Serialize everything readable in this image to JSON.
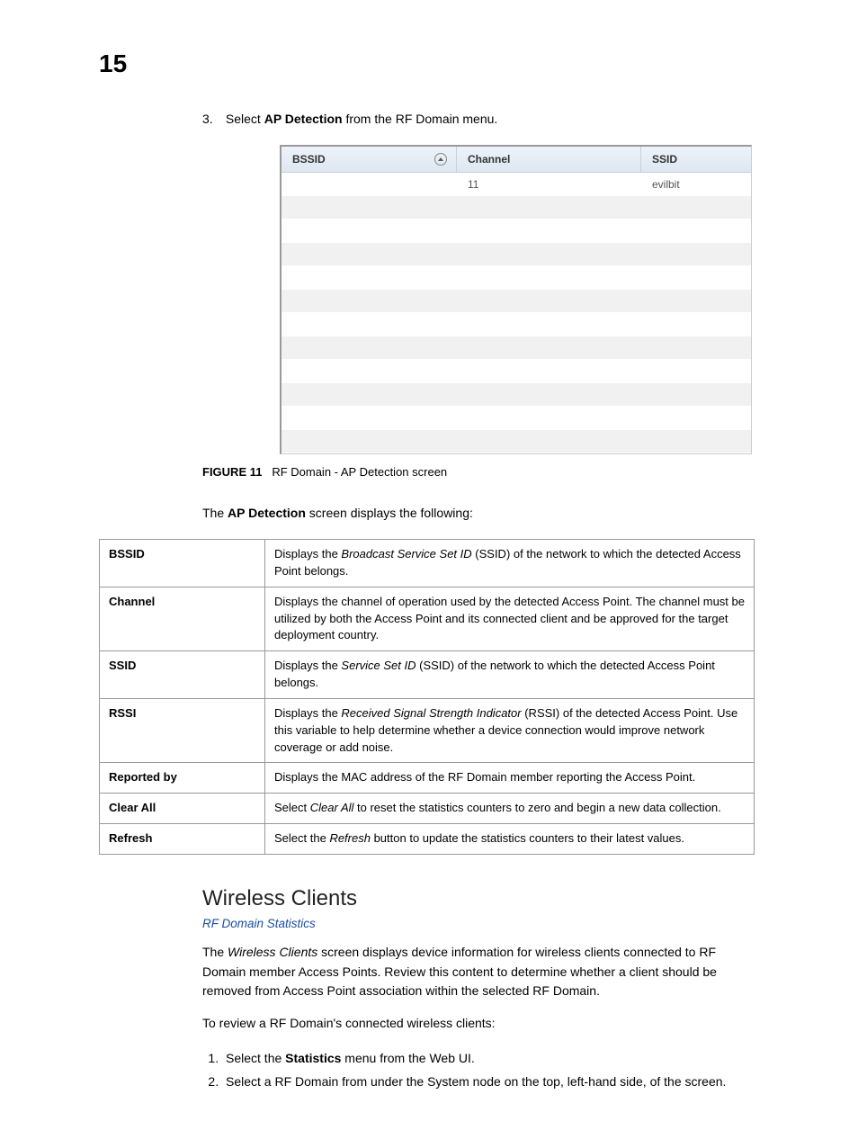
{
  "page_number": "15",
  "step3": {
    "num": "3.",
    "pre": "Select ",
    "bold": "AP Detection",
    "post": " from the RF Domain menu."
  },
  "shot": {
    "headers": {
      "bssid": "BSSID",
      "channel": "Channel",
      "ssid": "SSID"
    },
    "rows": [
      {
        "bssid": "",
        "channel": "11",
        "ssid": "evilbit"
      },
      {
        "bssid": "",
        "channel": "",
        "ssid": ""
      },
      {
        "bssid": "",
        "channel": "",
        "ssid": ""
      },
      {
        "bssid": "",
        "channel": "",
        "ssid": ""
      },
      {
        "bssid": "",
        "channel": "",
        "ssid": ""
      },
      {
        "bssid": "",
        "channel": "",
        "ssid": ""
      },
      {
        "bssid": "",
        "channel": "",
        "ssid": ""
      },
      {
        "bssid": "",
        "channel": "",
        "ssid": ""
      },
      {
        "bssid": "",
        "channel": "",
        "ssid": ""
      },
      {
        "bssid": "",
        "channel": "",
        "ssid": ""
      },
      {
        "bssid": "",
        "channel": "",
        "ssid": ""
      },
      {
        "bssid": "",
        "channel": "",
        "ssid": ""
      }
    ]
  },
  "figure": {
    "label": "FIGURE 11",
    "caption": "RF Domain - AP Detection screen"
  },
  "lead": {
    "pre": "The ",
    "bold": "AP Detection",
    "post": " screen displays the following:"
  },
  "desc": [
    {
      "key": "BSSID",
      "pre": "Displays the ",
      "ital": "Broadcast Service Set ID",
      "post": " (SSID) of the network to which the detected Access Point belongs."
    },
    {
      "key": "Channel",
      "pre": "",
      "ital": "",
      "post": "Displays the channel of operation used by the detected Access Point. The channel must be utilized by both the Access Point and its connected client and be approved for the target deployment country."
    },
    {
      "key": "SSID",
      "pre": "Displays the ",
      "ital": "Service Set ID",
      "post": " (SSID) of the network to which the detected Access Point belongs."
    },
    {
      "key": "RSSI",
      "pre": "Displays the ",
      "ital": "Received Signal Strength Indicator",
      "post": " (RSSI) of the detected Access Point. Use this variable to help determine whether a device connection would improve network coverage or add noise."
    },
    {
      "key": "Reported by",
      "pre": "",
      "ital": "",
      "post": "Displays the MAC address of the RF Domain member reporting the Access Point."
    },
    {
      "key": "Clear All",
      "pre": "Select ",
      "ital": "Clear All",
      "post": " to reset the statistics counters to zero and begin a new data collection."
    },
    {
      "key": "Refresh",
      "pre": "Select the ",
      "ital": "Refresh",
      "post": " button to update the statistics counters to their latest values."
    }
  ],
  "section_heading": "Wireless Clients",
  "link_text": "RF Domain Statistics",
  "wc_para": {
    "pre": "The ",
    "ital": "Wireless Clients",
    "post": " screen displays device information for wireless clients connected to RF Domain member Access Points. Review this content to determine whether a client should be removed from Access Point association within the selected RF Domain."
  },
  "wc_intro": "To review a RF Domain's connected wireless clients:",
  "wc_steps": [
    {
      "pre": "Select the ",
      "bold": "Statistics",
      "post": " menu from the Web UI."
    },
    {
      "pre": "",
      "bold": "",
      "post": "Select a RF Domain from under the System node on the top, left-hand side, of the screen."
    }
  ]
}
